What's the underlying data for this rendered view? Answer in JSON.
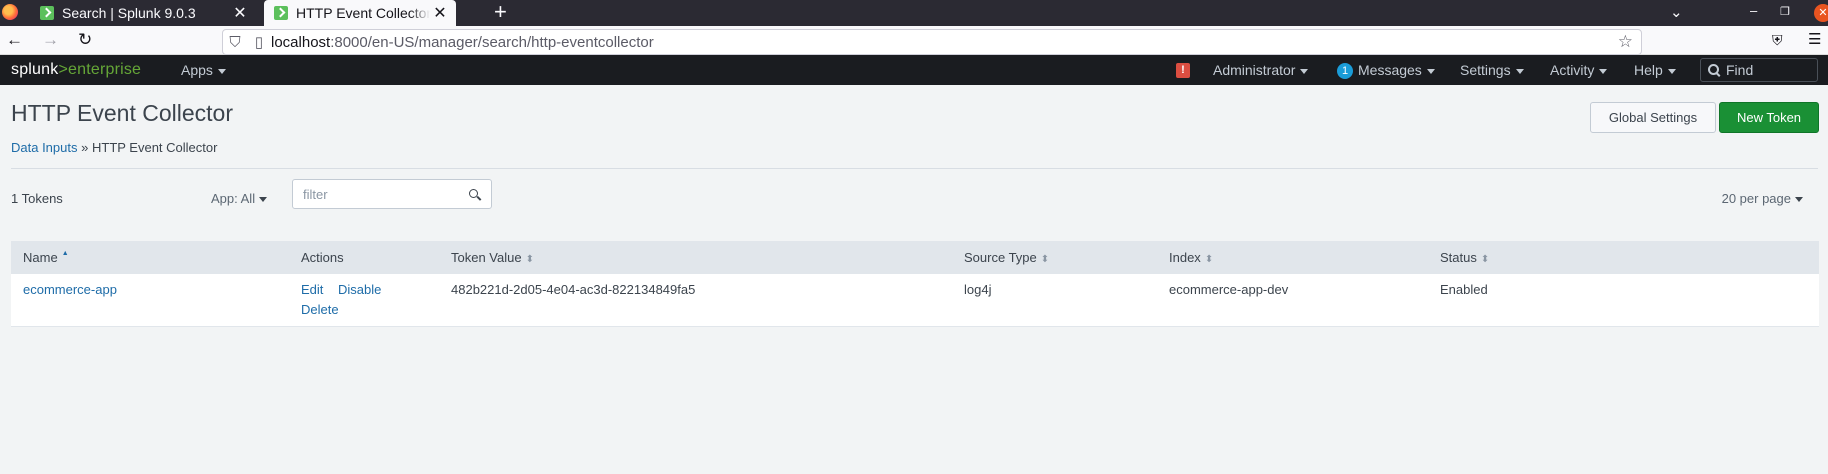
{
  "browser": {
    "tabs": [
      {
        "title": "Search | Splunk 9.0.3",
        "active": false
      },
      {
        "title": "HTTP Event Collector | Splunk",
        "active": true
      }
    ],
    "url_host": "localhost",
    "url_rest": ":8000/en-US/manager/search/http-eventcollector"
  },
  "splunkbar": {
    "logo_main": "splunk",
    "logo_sep": ">",
    "logo_sub": "enterprise",
    "apps": "Apps",
    "alert": "!",
    "user": "Administrator",
    "messages_count": "1",
    "messages": "Messages",
    "settings": "Settings",
    "activity": "Activity",
    "help": "Help",
    "find_placeholder": "Find"
  },
  "page": {
    "title": "HTTP Event Collector",
    "breadcrumb_link": "Data Inputs",
    "breadcrumb_sep": "»",
    "breadcrumb_current": "HTTP Event Collector",
    "global_settings": "Global Settings",
    "new_token": "New Token"
  },
  "toolbar": {
    "token_count": "1 Tokens",
    "app_filter": "App: All",
    "filter_placeholder": "filter",
    "per_page": "20 per page"
  },
  "table": {
    "columns": {
      "name": "Name",
      "actions": "Actions",
      "token_value": "Token Value",
      "source_type": "Source Type",
      "index": "Index",
      "status": "Status"
    },
    "rows": [
      {
        "name": "ecommerce-app",
        "action_edit": "Edit",
        "action_disable": "Disable",
        "action_delete": "Delete",
        "token_value": "482b221d-2d05-4e04-ac3d-822134849fa5",
        "source_type": "log4j",
        "index": "ecommerce-app-dev",
        "status": "Enabled"
      }
    ]
  },
  "colors": {
    "brand_green": "#65a637",
    "primary_button": "#1a9035",
    "link": "#1e6ca8",
    "alert": "#dc4e41",
    "badge": "#1a9cd8"
  }
}
